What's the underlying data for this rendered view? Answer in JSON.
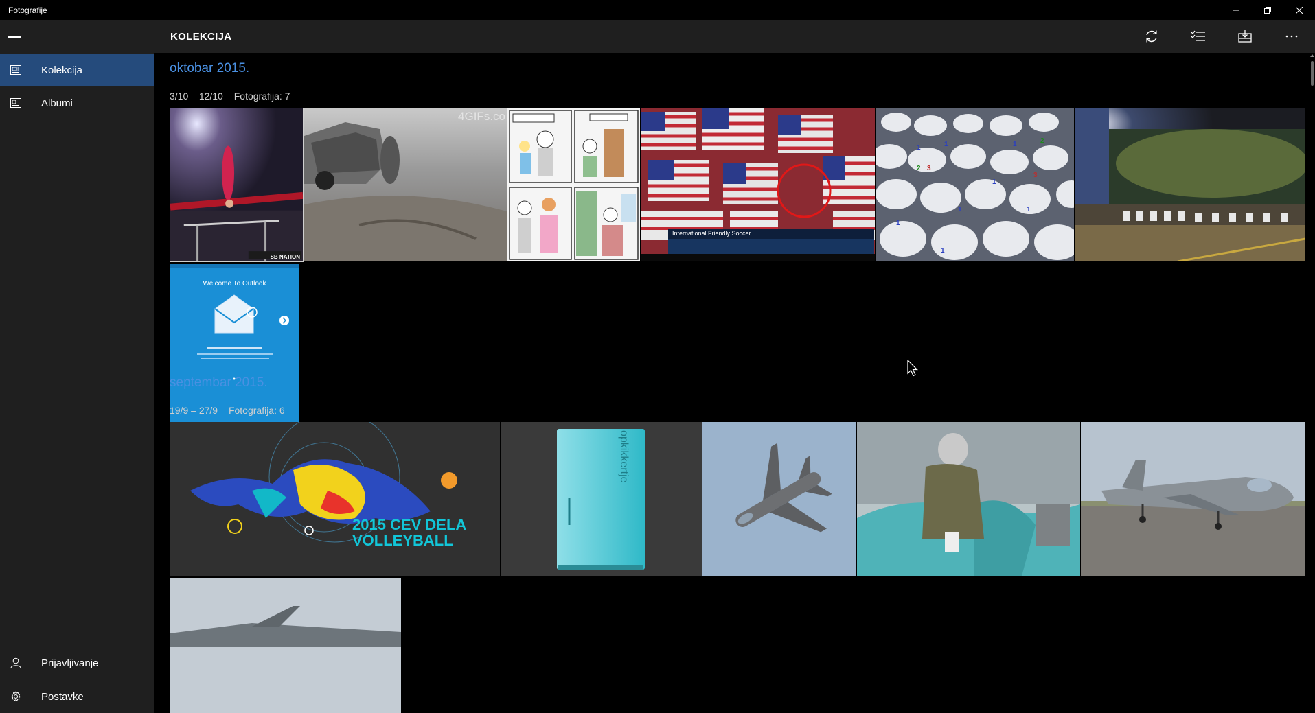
{
  "window": {
    "title": "Fotografije",
    "controls": [
      "minimize",
      "restore",
      "close"
    ]
  },
  "sidebar": {
    "items": [
      {
        "label": "Kolekcija",
        "icon": "collection-icon",
        "active": true
      },
      {
        "label": "Albumi",
        "icon": "album-icon",
        "active": false
      }
    ],
    "bottom_items": [
      {
        "label": "Prijavljivanje",
        "icon": "person-icon"
      },
      {
        "label": "Postavke",
        "icon": "gear-icon"
      }
    ]
  },
  "header": {
    "title": "KOLEKCIJA",
    "toolbar": [
      "refresh-icon",
      "select-icon",
      "import-icon",
      "more-icon"
    ]
  },
  "sections": [
    {
      "month": "oktobar 2015.",
      "range": "3/10 – 12/10",
      "count": "Fotografija: 7",
      "photos": [
        {
          "name": "gymnastics-photo",
          "overlay": "SB NATION"
        },
        {
          "name": "car-mud-gif",
          "overlay": "4GIFs.co"
        },
        {
          "name": "comic-strip",
          "overlay": ""
        },
        {
          "name": "flags-crowd-tv",
          "overlay": "International Friendly Soccer"
        },
        {
          "name": "crowd-prayer-photo",
          "overlay": ""
        },
        {
          "name": "night-street-photo",
          "overlay": ""
        },
        {
          "name": "outlook-welcome",
          "overlay": "Welcome To Outlook"
        }
      ]
    },
    {
      "month": "septembar 2015.",
      "range": "19/9 – 27/9",
      "count": "Fotografija: 6",
      "photos": [
        {
          "name": "volleyball-poster",
          "overlay": "2015 CEV DELA VOLLEYBALL"
        },
        {
          "name": "fridge-photo",
          "overlay": "opkikkertje"
        },
        {
          "name": "jet-sky-photo",
          "overlay": ""
        },
        {
          "name": "pilot-cockpit-photo",
          "overlay": ""
        },
        {
          "name": "jet-ground-photo",
          "overlay": ""
        },
        {
          "name": "jet-partial-photo",
          "overlay": ""
        }
      ]
    }
  ]
}
